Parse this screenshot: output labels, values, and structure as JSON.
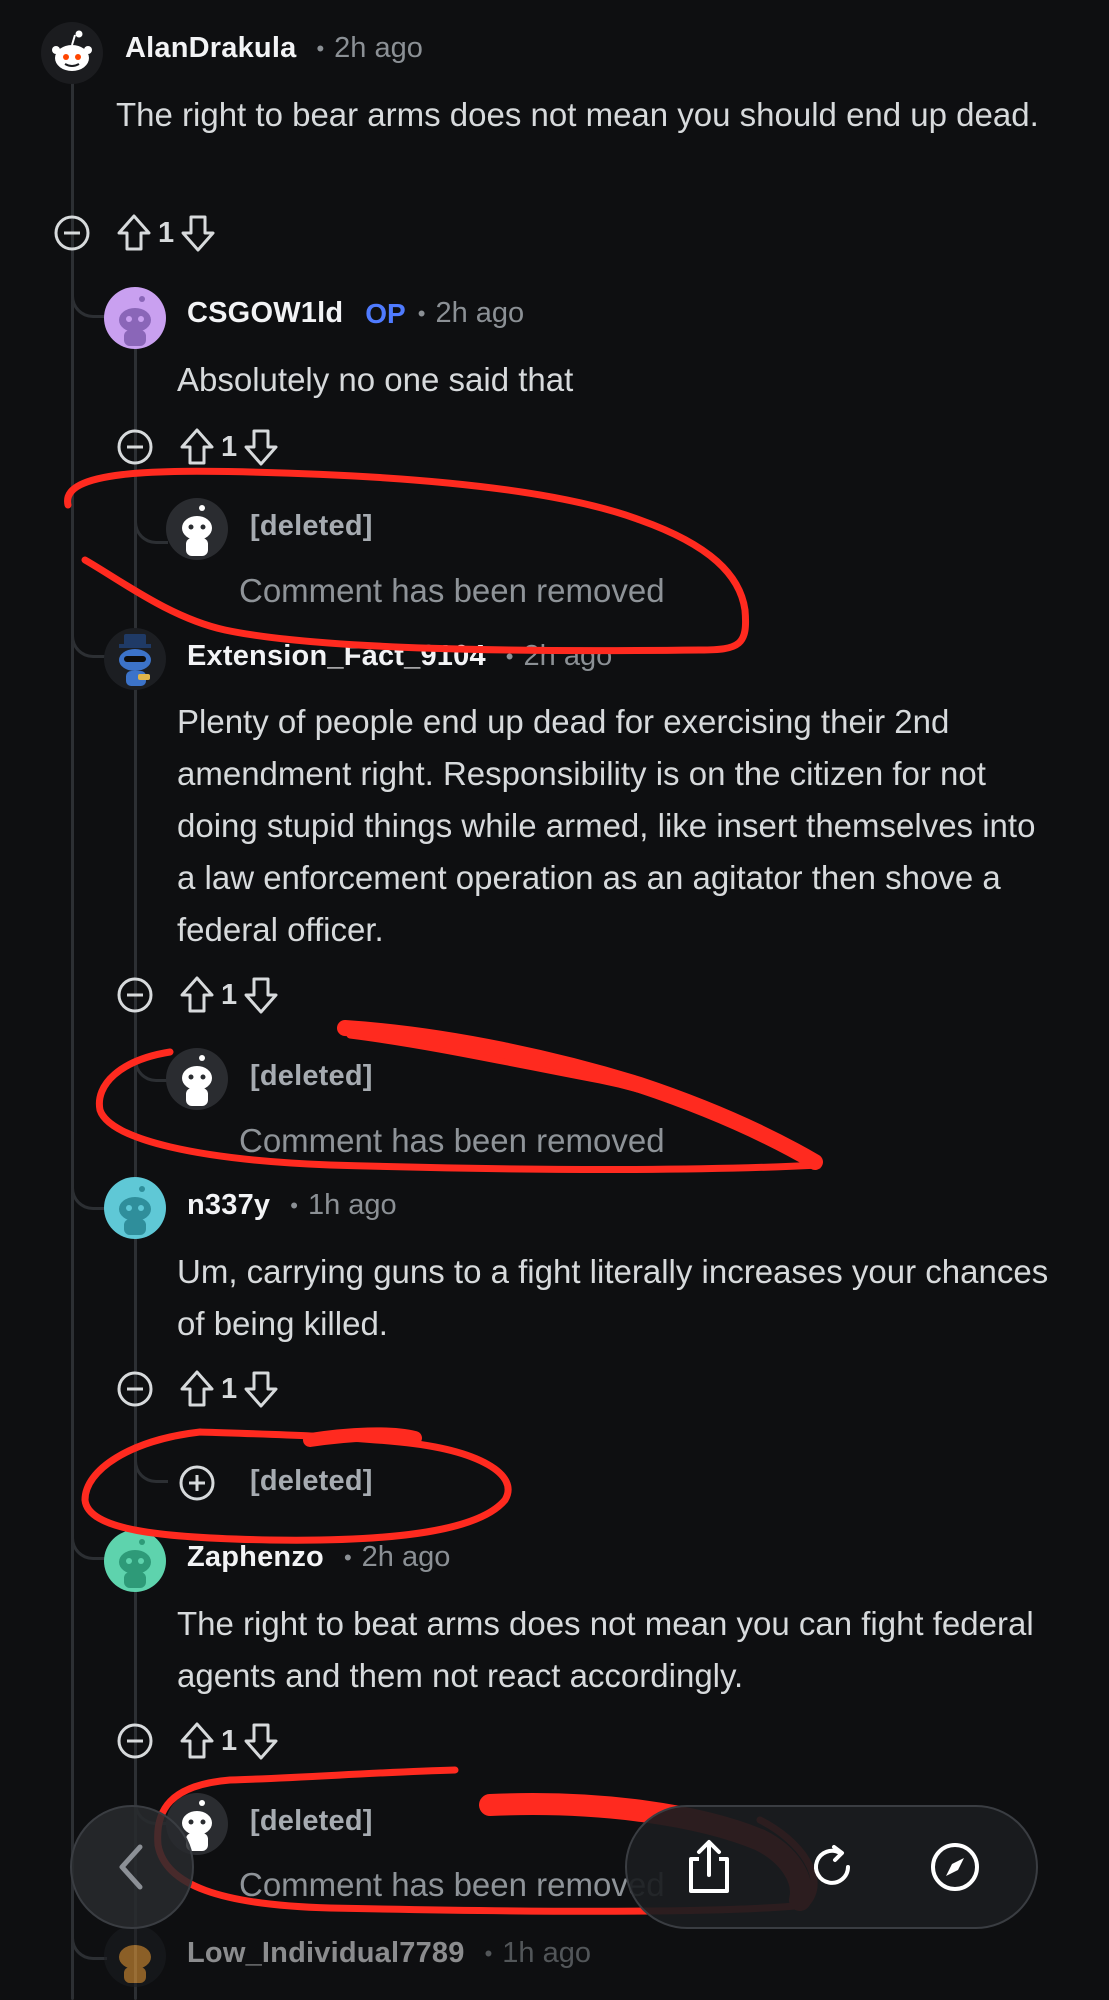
{
  "comments": [
    {
      "username": "AlanDrakula",
      "time": "2h ago",
      "body": "The right to bear arms does not mean you should end up dead.",
      "score": "1",
      "avatar_color": "#ffffff"
    },
    {
      "username": "CSGOW1ld",
      "op_badge": "OP",
      "time": "2h ago",
      "body": "Absolutely no one said that",
      "score": "1",
      "avatar_color": "#c9a0f0"
    },
    {
      "username": "[deleted]",
      "removed": "Comment has been removed"
    },
    {
      "username": "Extension_Fact_9104",
      "time": "2h ago",
      "body": "Plenty of people end up dead for exercising their 2nd amendment right. Responsibility is on the citizen for not doing stupid things while armed, like insert themselves into a law enforcement operation as an agitator then shove a federal officer.",
      "score": "1",
      "avatar_color": "#1f3a66"
    },
    {
      "username": "[deleted]",
      "removed": "Comment has been removed"
    },
    {
      "username": "n337y",
      "time": "1h ago",
      "body": "Um, carrying guns to a fight literally increases your chances of being killed.",
      "score": "1",
      "avatar_color": "#5fc8d6"
    },
    {
      "username": "[deleted]"
    },
    {
      "username": "Zaphenzo",
      "time": "2h ago",
      "body": "The right to beat arms does not mean you can fight federal agents and them not react accordingly.",
      "score": "1",
      "avatar_color": "#5ed3ad"
    },
    {
      "username": "[deleted]",
      "removed": "Comment has been removed"
    },
    {
      "username": "Low_Individual7789",
      "time": "1h ago",
      "avatar_color": "#f2a23a"
    }
  ],
  "icons": {
    "collapse": "minus-circle-icon",
    "expand": "plus-circle-icon",
    "upvote": "arrow-up-icon",
    "downvote": "arrow-down-icon",
    "back": "chevron-left-icon",
    "share": "share-icon",
    "reload": "reload-icon",
    "browser": "compass-icon"
  },
  "colors": {
    "background": "#0e0f11",
    "op_badge": "#4f7bff",
    "annotation": "#ff2a1f"
  }
}
